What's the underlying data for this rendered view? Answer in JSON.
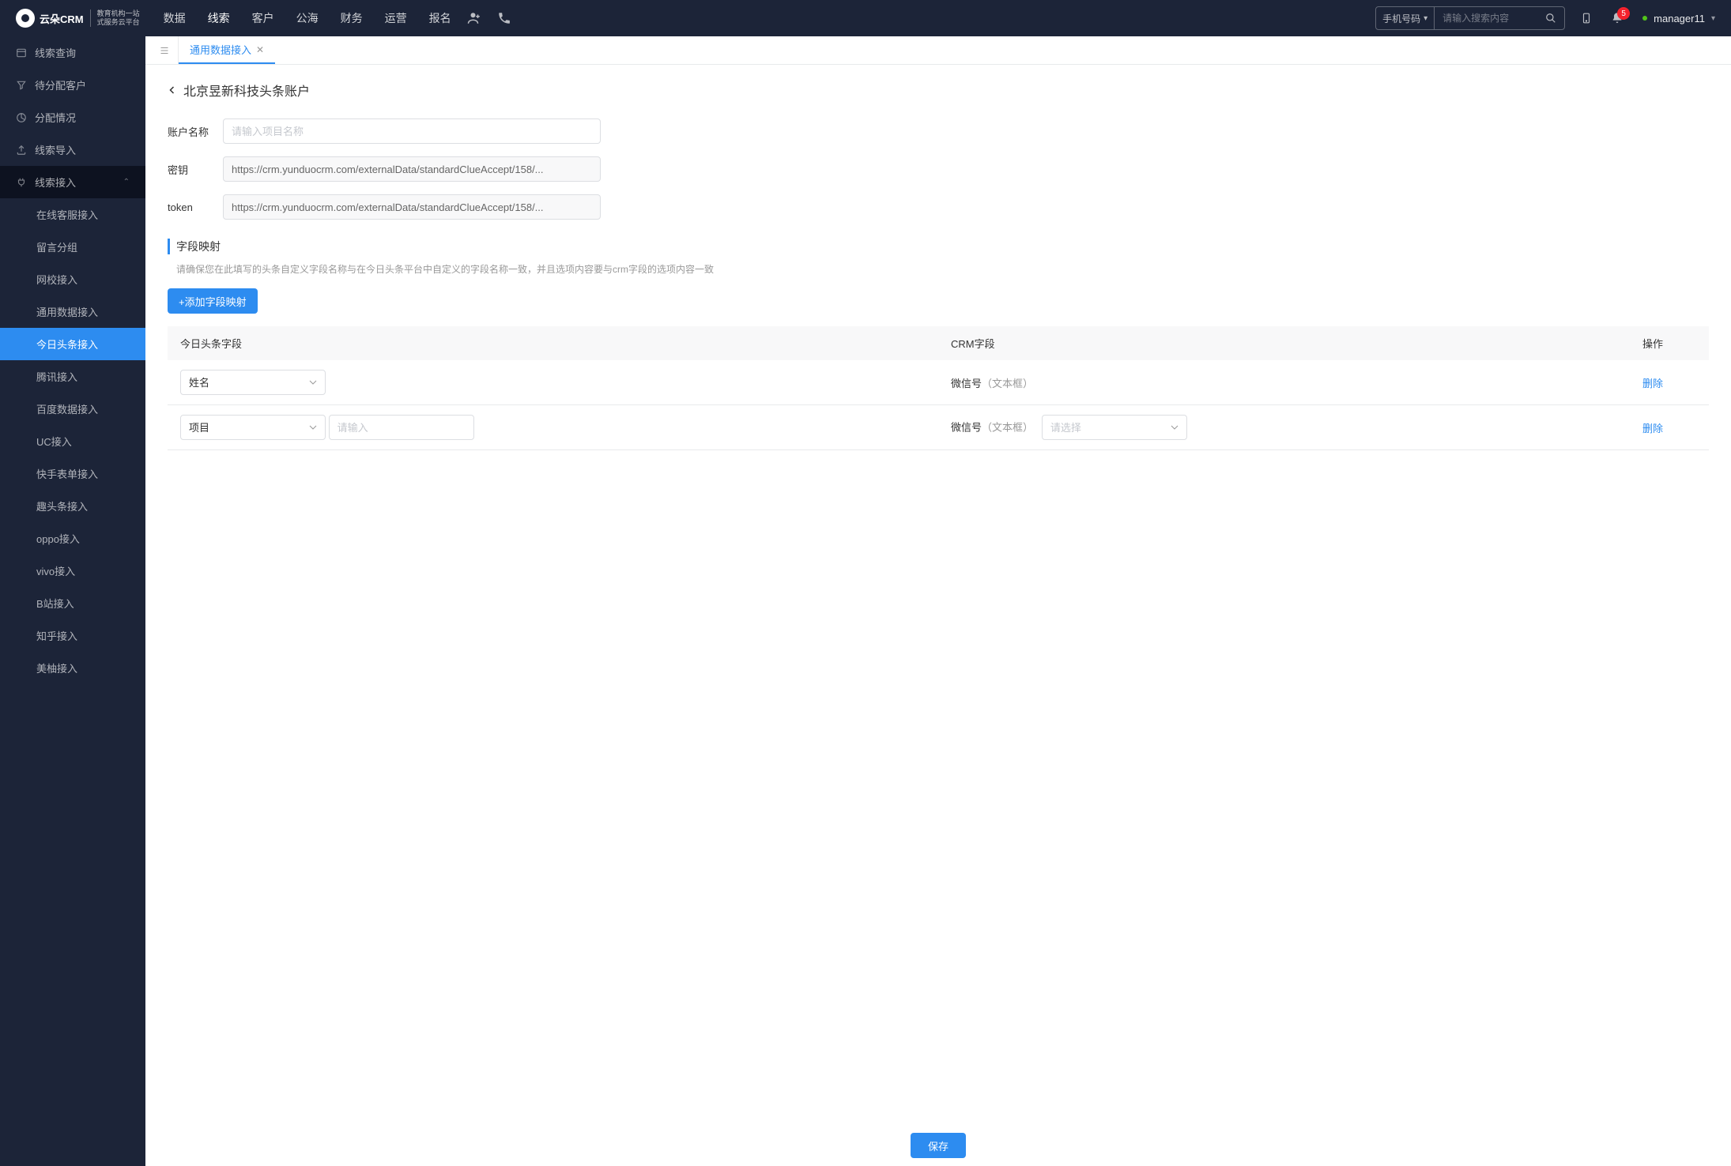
{
  "header": {
    "logo_text": "云朵CRM",
    "logo_sub1": "教育机构一站",
    "logo_sub2": "式服务云平台",
    "nav": [
      "数据",
      "线索",
      "客户",
      "公海",
      "财务",
      "运营",
      "报名"
    ],
    "nav_active": 1,
    "search_select": "手机号码",
    "search_placeholder": "请输入搜索内容",
    "badge": "5",
    "user": "manager11"
  },
  "sidebar": {
    "items": [
      {
        "label": "线索查询",
        "icon": "list"
      },
      {
        "label": "待分配客户",
        "icon": "filter"
      },
      {
        "label": "分配情况",
        "icon": "pie"
      },
      {
        "label": "线索导入",
        "icon": "upload"
      },
      {
        "label": "线索接入",
        "icon": "plug",
        "expanded": true,
        "children": [
          "在线客服接入",
          "留言分组",
          "网校接入",
          "通用数据接入",
          "今日头条接入",
          "腾讯接入",
          "百度数据接入",
          "UC接入",
          "快手表单接入",
          "趣头条接入",
          "oppo接入",
          "vivo接入",
          "B站接入",
          "知乎接入",
          "美柚接入"
        ],
        "active_child": 4
      }
    ]
  },
  "tabs": {
    "active_label": "通用数据接入"
  },
  "page": {
    "title": "北京昱新科技头条账户",
    "form": {
      "account_label": "账户名称",
      "account_placeholder": "请输入项目名称",
      "secret_label": "密钥",
      "secret_value": "https://crm.yunduocrm.com/externalData/standardClueAccept/158/...",
      "token_label": "token",
      "token_value": "https://crm.yunduocrm.com/externalData/standardClueAccept/158/..."
    },
    "mapping": {
      "heading": "字段映射",
      "desc": "请确保您在此填写的头条自定义字段名称与在今日头条平台中自定义的字段名称一致，并且选项内容要与crm字段的选项内容一致",
      "add_btn": "+添加字段映射",
      "cols": [
        "今日头条字段",
        "CRM字段",
        "操作"
      ],
      "rows": [
        {
          "tt_field": "姓名",
          "crm_name": "微信号",
          "crm_type": "（文本框）",
          "del": "删除"
        },
        {
          "tt_field": "项目",
          "tt_input_ph": "请输入",
          "crm_name": "微信号",
          "crm_type": "（文本框）",
          "crm_select_ph": "请选择",
          "del": "删除"
        }
      ]
    },
    "save": "保存"
  }
}
